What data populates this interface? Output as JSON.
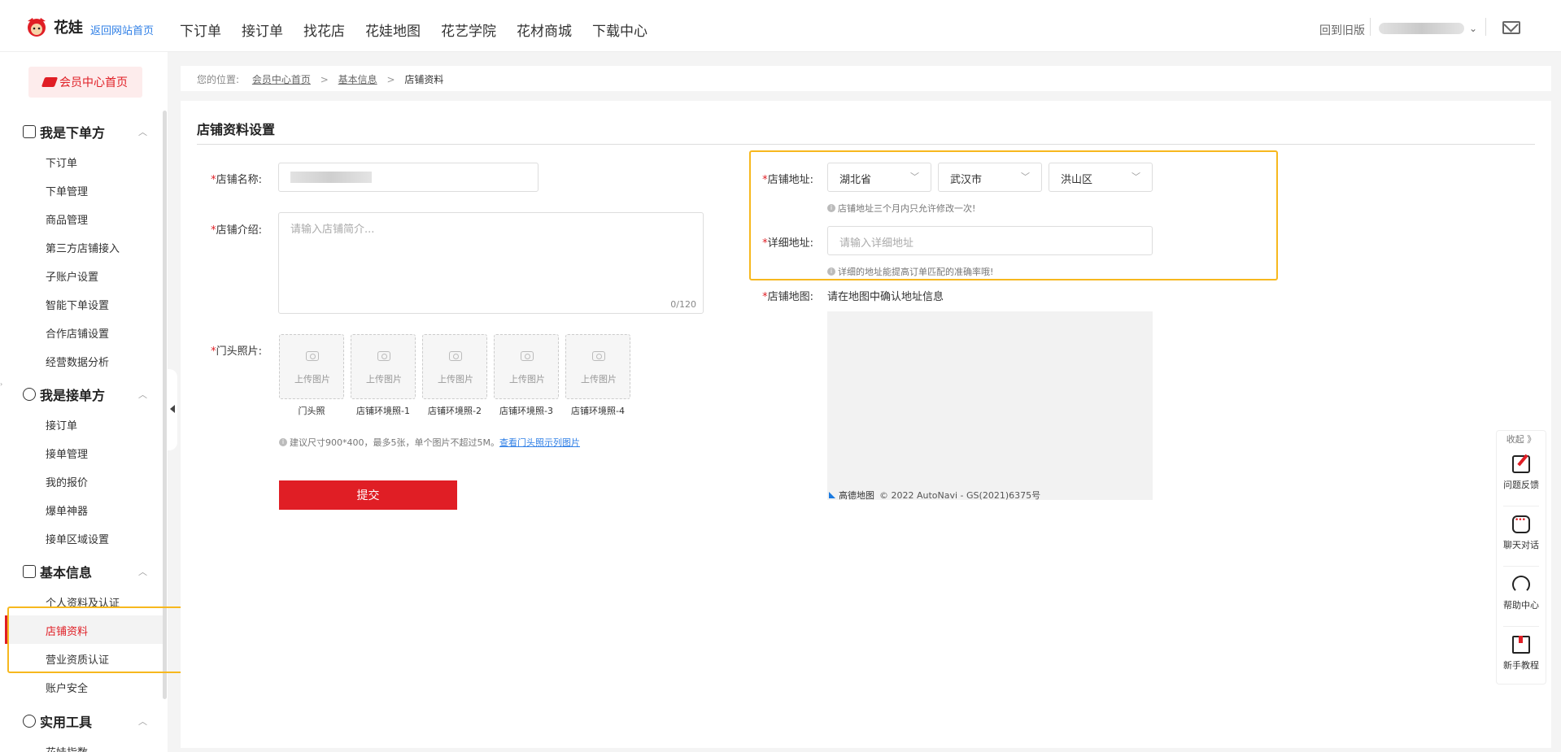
{
  "header": {
    "logo_text": "花娃",
    "home_link": "返回网站首页",
    "nav": [
      "下订单",
      "接订单",
      "找花店",
      "花娃地图",
      "花艺学院",
      "花材商城",
      "下载中心"
    ],
    "old_version": "回到旧版"
  },
  "sidebar": {
    "member_home": "会员中心首页",
    "groups": [
      {
        "title": "我是下单方",
        "items": [
          "下订单",
          "下单管理",
          "商品管理",
          "第三方店铺接入",
          "子账户设置",
          "智能下单设置",
          "合作店铺设置",
          "经营数据分析"
        ]
      },
      {
        "title": "我是接单方",
        "items": [
          "接订单",
          "接单管理",
          "我的报价",
          "爆单神器",
          "接单区域设置"
        ]
      },
      {
        "title": "基本信息",
        "items": [
          "个人资料及认证",
          "店铺资料",
          "营业资质认证",
          "账户安全"
        ]
      },
      {
        "title": "实用工具",
        "items": [
          "花娃指数"
        ]
      }
    ],
    "active_item": "店铺资料"
  },
  "breadcrumb": {
    "prefix": "您的位置:",
    "items": [
      "会员中心首页",
      "基本信息"
    ],
    "current": "店铺资料",
    "separator": ">"
  },
  "form": {
    "title": "店铺资料设置",
    "required_mark": "*",
    "name_label": "店铺名称:",
    "intro_label": "店铺介绍:",
    "intro_placeholder": "请输入店铺简介...",
    "intro_counter": "0/120",
    "photo_label": "门头照片:",
    "upload_text": "上传图片",
    "photo_captions": [
      "门头照",
      "店铺环境照-1",
      "店铺环境照-2",
      "店铺环境照-3",
      "店铺环境照-4"
    ],
    "photo_hint": "建议尺寸900*400，最多5张，单个图片不超过5M。",
    "photo_hint_link": "查看门头照示列图片",
    "submit": "提交",
    "address_label": "店铺地址:",
    "province": "湖北省",
    "city": "武汉市",
    "district": "洪山区",
    "address_hint": "店铺地址三个月内只允许修改一次!",
    "detail_label": "详细地址:",
    "detail_placeholder": "请输入详细地址",
    "detail_hint": "详细的地址能提高订单匹配的准确率哦!",
    "map_label": "店铺地图:",
    "map_text": "请在地图中确认地址信息",
    "map_brand": "高德地图",
    "map_copyright": "© 2022 AutoNavi - GS(2021)6375号"
  },
  "float_bar": {
    "collapse": "收起 》",
    "items": [
      "问题反馈",
      "聊天对话",
      "帮助中心",
      "新手教程"
    ]
  },
  "colors": {
    "brand_red": "#e01e25",
    "highlight": "#f7b81e",
    "link_blue": "#2f7fe6"
  }
}
